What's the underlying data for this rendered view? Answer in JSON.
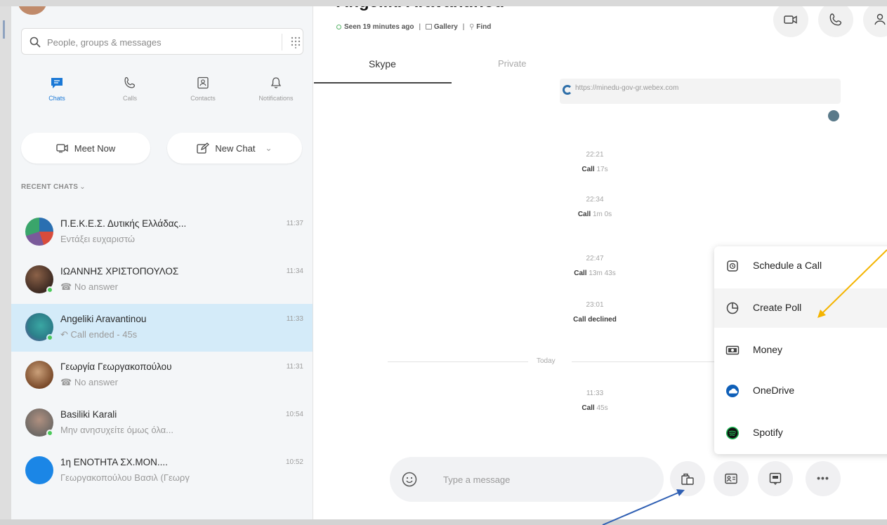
{
  "search": {
    "placeholder": "People, groups & messages"
  },
  "nav": [
    {
      "label": "Chats"
    },
    {
      "label": "Calls"
    },
    {
      "label": "Contacts"
    },
    {
      "label": "Notifications"
    }
  ],
  "actions": {
    "meet_now": "Meet Now",
    "new_chat": "New Chat"
  },
  "recent_label": "RECENT CHATS",
  "chats": [
    {
      "name": "Π.Ε.Κ.Ε.Σ. Δυτικής Ελλάδας...",
      "preview": "Εντάξει ευχαριστώ",
      "time": "11:37"
    },
    {
      "name": "ΙΩΑΝΝΗΣ ΧΡΙΣΤΟΠΟΥΛΟΣ",
      "preview": "No answer",
      "time": "11:34"
    },
    {
      "name": "Angeliki Aravantinou",
      "preview": "Call ended - 45s",
      "time": "11:33"
    },
    {
      "name": "Γεωργία Γεωργακοπούλου",
      "preview": "No answer",
      "time": "11:31"
    },
    {
      "name": "Basiliki Karali",
      "preview": "Μην ανησυχείτε όμως όλα...",
      "time": "10:54"
    },
    {
      "name": "1η ΕΝΟΤΗΤΑ ΣΧ.ΜΟΝ....",
      "preview": "Γεωργακοπούλου Βασιλ (Γεωργ",
      "time": "10:52"
    }
  ],
  "conversation": {
    "title": "Angeliki Aravantinou",
    "seen": "Seen 19 minutes ago",
    "gallery": "Gallery",
    "find": "Find",
    "tabs": [
      "Skype",
      "Private"
    ],
    "link": "https://minedu-gov-gr.webex.com",
    "messages": [
      {
        "time": "22:21",
        "label": "Call",
        "detail": "17s"
      },
      {
        "time": "22:34",
        "label": "Call",
        "detail": "1m 0s"
      },
      {
        "time": "22:47",
        "label": "Call",
        "detail": "13m 43s"
      },
      {
        "time": "23:01",
        "label": "Call declined",
        "detail": ""
      },
      {
        "time": "11:33",
        "label": "Call",
        "detail": "45s"
      }
    ],
    "today": "Today"
  },
  "menu": [
    "Schedule a Call",
    "Create Poll",
    "Money",
    "OneDrive",
    "Spotify"
  ],
  "composer": {
    "placeholder": "Type a message"
  },
  "colors": {
    "accent": "#1a78d6",
    "selected_row": "#d4ebf9",
    "arrow_orange": "#f4b400",
    "arrow_blue": "#2f5fb3"
  }
}
